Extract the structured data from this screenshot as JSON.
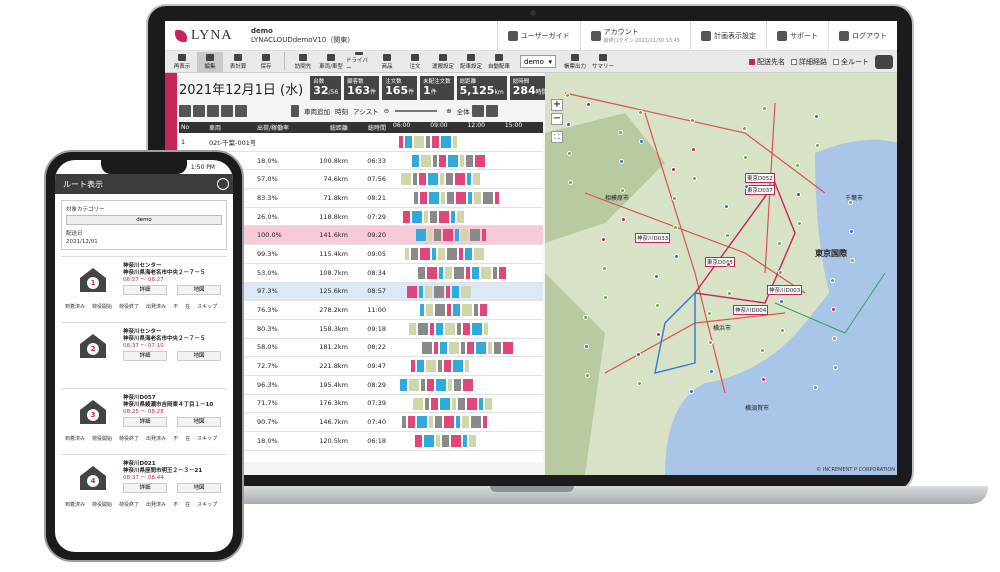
{
  "app": {
    "logo": "LYNA",
    "user_name": "demo",
    "user_org": "LYNACLOUDdemoV10（関東）",
    "header_buttons": [
      {
        "label": "ユーザーガイド",
        "icon": "book-icon"
      },
      {
        "label": "アカウント",
        "icon": "user-icon"
      },
      {
        "label": "計画表示設定",
        "icon": "gear-icon"
      },
      {
        "label": "サポート",
        "icon": "support-icon"
      },
      {
        "label": "ログアウト",
        "icon": "logout-icon"
      }
    ],
    "account_sub": "最終ログイン 2021/11/30 13:45"
  },
  "toolbar": {
    "buttons": [
      "再表示",
      "編集",
      "表計算",
      "保存",
      "訪問先",
      "車両/車型",
      "ドライバー",
      "商品",
      "注文",
      "運搬設定",
      "配車設定",
      "自動配車"
    ],
    "select_value": "demo",
    "view_buttons": [
      "帳票出力",
      "サマリー"
    ],
    "checks": [
      {
        "label": "配送先名",
        "on": true
      },
      {
        "label": "詳細経路",
        "on": false
      },
      {
        "label": "全ルート",
        "on": false
      }
    ]
  },
  "side_tab": "注文を見る",
  "summary": {
    "date": "2021年12月1日 (水)",
    "stats": [
      {
        "label": "台数",
        "value": "32",
        "unit": "/56"
      },
      {
        "label": "顧客数",
        "value": "163",
        "unit": "件"
      },
      {
        "label": "注文数",
        "value": "165",
        "unit": "件"
      },
      {
        "label": "未配注文数",
        "value": "1",
        "unit": "件"
      },
      {
        "label": "総距離",
        "value": "5,125",
        "unit": "km"
      },
      {
        "label": "総時間",
        "value": "284",
        "unit": "時間58分"
      }
    ]
  },
  "actions": {
    "add_vehicle": "車両追加",
    "time_label": "時刻",
    "assist_label": "アシスト",
    "all_label": "全体"
  },
  "table": {
    "headers": [
      "No",
      "車両",
      "出荷/稼働率",
      "総距離",
      "総時間"
    ],
    "time_ticks": [
      "06:00",
      "09:00",
      "12:00",
      "15:00"
    ],
    "rows": [
      {
        "no": "1",
        "name": "02t-千葉-001号車",
        "rate": "",
        "dist": "",
        "time": ""
      },
      {
        "no": "",
        "name": "号車",
        "rate": "18.0%",
        "dist": "100.8km",
        "time": "06:33"
      },
      {
        "no": "",
        "name": "号車",
        "rate": "57.0%",
        "dist": "74.6km",
        "time": "07:56"
      },
      {
        "no": "",
        "name": "号車",
        "rate": "83.3%",
        "dist": "71.8km",
        "time": "08:21"
      },
      {
        "no": "",
        "name": "号車",
        "rate": "26.0%",
        "dist": "118.8km",
        "time": "07:29"
      },
      {
        "no": "",
        "name": "02号車",
        "rate": "100.0%",
        "dist": "141.6km",
        "time": "09:20"
      },
      {
        "no": "",
        "name": "号車",
        "rate": "99.3%",
        "dist": "115.4km",
        "time": "09:05"
      },
      {
        "no": "",
        "name": "号車",
        "rate": "53.0%",
        "dist": "108.7km",
        "time": "08:34"
      },
      {
        "no": "",
        "name": "5号車",
        "rate": "97.3%",
        "dist": "125.6km",
        "time": "08:57"
      },
      {
        "no": "",
        "name": "号車",
        "rate": "76.3%",
        "dist": "278.2km",
        "time": "11:00"
      },
      {
        "no": "",
        "name": "号車",
        "rate": "80.3%",
        "dist": "158.3km",
        "time": "09:18"
      },
      {
        "no": "",
        "name": "号車",
        "rate": "58.0%",
        "dist": "181.2km",
        "time": "08:22"
      },
      {
        "no": "",
        "name": "号車",
        "rate": "72.7%",
        "dist": "221.8km",
        "time": "09:47"
      },
      {
        "no": "",
        "name": "02号車",
        "rate": "96.3%",
        "dist": "195.4km",
        "time": "08:29"
      },
      {
        "no": "",
        "name": "号車",
        "rate": "71.7%",
        "dist": "176.3km",
        "time": "07:39"
      },
      {
        "no": "",
        "name": "-001号車",
        "rate": "90.7%",
        "dist": "146.7km",
        "time": "07:40"
      },
      {
        "no": "",
        "name": "-002号車",
        "rate": "18.0%",
        "dist": "120.5km",
        "time": "06:18"
      }
    ]
  },
  "map": {
    "labels": [
      "東京国際",
      "神奈川D003",
      "神奈川D004",
      "神奈川D033",
      "東京D052",
      "東京D037",
      "東京D048",
      "横浜市",
      "千葉市",
      "横須賀市",
      "相模原市"
    ],
    "copyright": "© INCREMENT P CORPORATION"
  },
  "phone": {
    "time": "1:50 PM",
    "title": "ルート表示",
    "category_label": "対象カテゴリー",
    "category_value": "demo",
    "date_label": "配送日",
    "date_value": "2021/12/01",
    "cards": [
      {
        "num": "1",
        "name": "神奈川センター",
        "addr": "神奈川県海老名市中央２－７－５",
        "time": "06:27 ～ 06:27",
        "steps": [
          "到着済み",
          "荷役開始",
          "荷役終了",
          "出発済み",
          "不",
          "在",
          "スキップ"
        ]
      },
      {
        "num": "2",
        "name": "神奈川センター",
        "addr": "神奈川県海老名市中央２－７－５",
        "time": "06:37 ～ 07:10",
        "steps": []
      },
      {
        "num": "3",
        "name": "神奈川D057",
        "addr": "神奈川県綾瀬市吉岡東４丁目１－10",
        "time": "08:25 ～ 08:28",
        "steps": [
          "到着済み",
          "荷役開始",
          "荷役終了",
          "出発済み",
          "不",
          "在",
          "スキップ"
        ]
      },
      {
        "num": "4",
        "name": "神奈川D021",
        "addr": "神奈川県座間市明王２－３－21",
        "time": "08:37 ～ 08:44",
        "steps": [
          "到着済み",
          "荷役開始",
          "荷役終了",
          "出発済み",
          "不",
          "在",
          "スキップ"
        ]
      }
    ],
    "detail_btn": "詳細",
    "map_btn": "地図"
  }
}
